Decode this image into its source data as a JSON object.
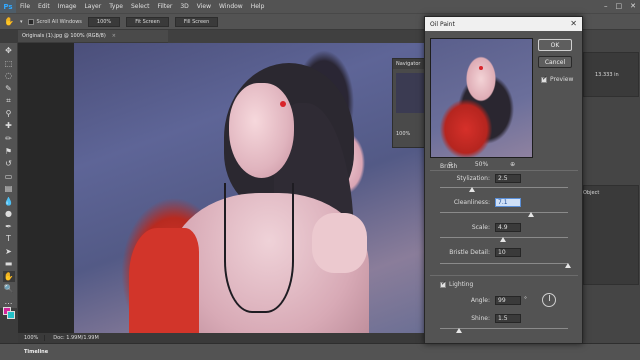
{
  "app": {
    "logo": "Ps",
    "menus": [
      "File",
      "Edit",
      "Image",
      "Layer",
      "Type",
      "Select",
      "Filter",
      "3D",
      "View",
      "Window",
      "Help"
    ],
    "window_controls": [
      "–",
      "□",
      "✕"
    ]
  },
  "options_bar": {
    "scroll_all_windows": "Scroll All Windows",
    "btn_100": "100%",
    "btn_fit": "Fit Screen",
    "btn_fill": "Fill Screen"
  },
  "document": {
    "tab_title": "Originals (1).jpg @ 100% (RGB/8)",
    "close": "×"
  },
  "navigator": {
    "title": "Navigator",
    "zoom": "100%"
  },
  "status": {
    "zoom": "100%",
    "doc": "Doc: 1.99M/1.99M"
  },
  "timeline": {
    "label": "Timeline"
  },
  "right_panel": {
    "info_w": "13.333 in",
    "object_label": "Object"
  },
  "dialog": {
    "title": "Oil Paint",
    "close": "✕",
    "ok": "OK",
    "cancel": "Cancel",
    "preview_label": "Preview",
    "preview_checked": true,
    "zoom_out": "⊖",
    "zoom_level": "50%",
    "zoom_in": "⊕",
    "brush": {
      "label": "Brush",
      "stylization": {
        "label": "Stylization:",
        "value": "2.5",
        "fraction": 0.25
      },
      "cleanliness": {
        "label": "Cleanliness:",
        "value": "7.1",
        "fraction": 0.71
      },
      "scale": {
        "label": "Scale:",
        "value": "4.9",
        "fraction": 0.49
      },
      "bristle_detail": {
        "label": "Bristle Detail:",
        "value": "10",
        "fraction": 1.0
      }
    },
    "lighting": {
      "label": "Lighting",
      "checked": true,
      "angle": {
        "label": "Angle:",
        "value": "99",
        "unit": "°"
      },
      "shine": {
        "label": "Shine:",
        "value": "1.5",
        "fraction": 0.15
      }
    }
  }
}
